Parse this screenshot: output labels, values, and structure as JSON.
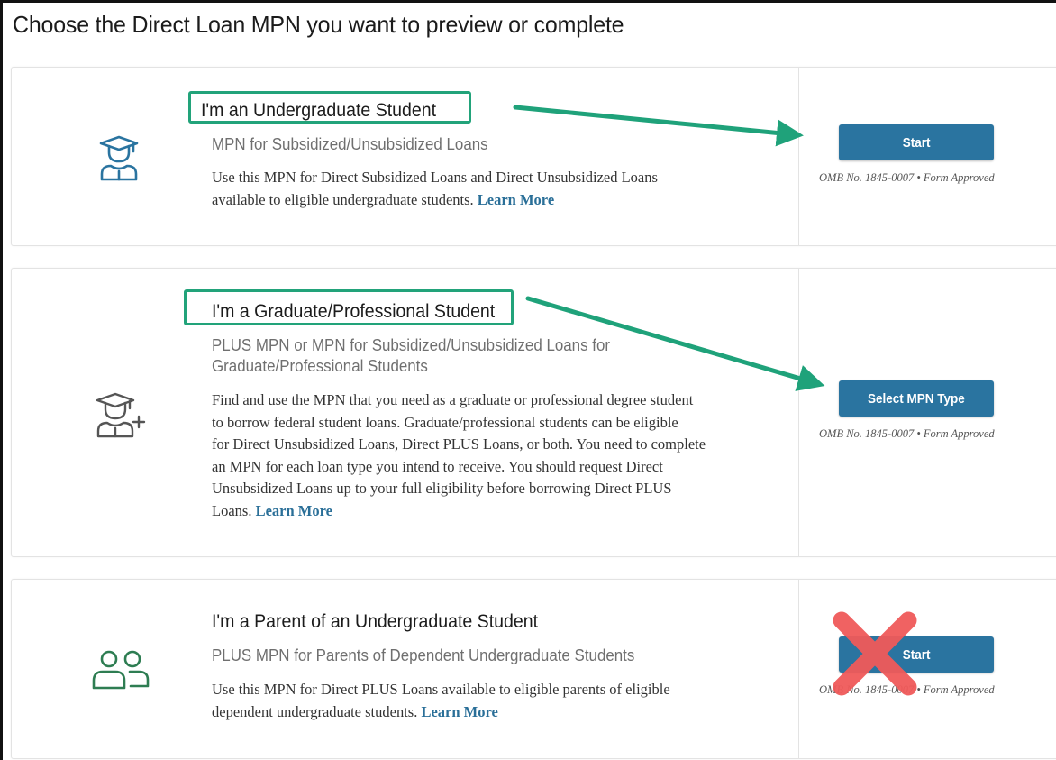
{
  "page": {
    "title": "Choose the Direct Loan MPN you want to preview or complete"
  },
  "cards": [
    {
      "title": "I'm an Undergraduate Student",
      "subtitle_lines": [
        "MPN for Subsidized/Unsubsidized Loans"
      ],
      "desc_lines": [
        "Use this MPN for Direct Subsidized Loans and Direct Unsubsidized Loans",
        "available to eligible undergraduate students."
      ],
      "learn_more": "Learn More",
      "button_label": "Start",
      "omb": "OMB No. 1845-0007  •  Form Approved",
      "icon": "graduate-student-icon",
      "icon_color": "#2a74a0"
    },
    {
      "title": "I'm a Graduate/Professional Student",
      "subtitle_lines": [
        "PLUS MPN or MPN for Subsidized/Unsubsidized Loans for",
        "Graduate/Professional Students"
      ],
      "desc_lines": [
        "Find and use the MPN that you need as a graduate or professional degree student",
        "to borrow federal student loans. Graduate/professional students can be eligible",
        "for Direct Unsubsidized Loans, Direct PLUS Loans, or both. You need to complete",
        "an MPN for each loan type you intend to receive. You should request Direct",
        "Unsubsidized Loans up to your full eligibility before borrowing Direct PLUS",
        "Loans."
      ],
      "learn_more": "Learn More",
      "button_label": "Select MPN Type",
      "omb": "OMB No. 1845-0007  •  Form Approved",
      "icon": "graduate-student-plus-icon",
      "icon_color": "#555555"
    },
    {
      "title": "I'm a Parent of an Undergraduate Student",
      "subtitle_lines": [
        "PLUS MPN for Parents of Dependent Undergraduate Students"
      ],
      "desc_lines": [
        "Use this MPN for Direct PLUS Loans available to eligible parents of eligible",
        "dependent undergraduate students."
      ],
      "learn_more": "Learn More",
      "button_label": "Start",
      "omb": "OMB No. 1845-0007  •  Form Approved",
      "icon": "parent-users-icon",
      "icon_color": "#2e7d52"
    }
  ],
  "annotations": {
    "highlight_color": "#22a37a",
    "arrow_color": "#1fa27a",
    "cross_color": "#f05a5a"
  }
}
